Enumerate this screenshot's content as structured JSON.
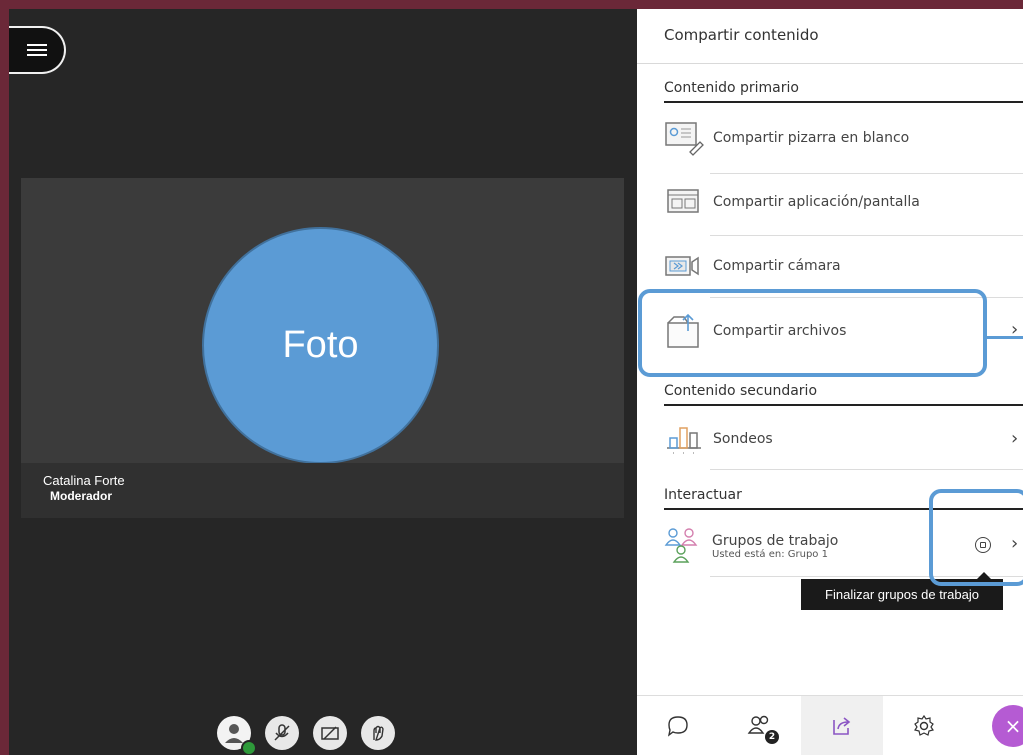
{
  "video": {
    "photo_label": "Foto",
    "participant_name": "Catalina Forte",
    "participant_role": "Moderador"
  },
  "panel": {
    "title": "Compartir contenido",
    "primary_heading": "Contenido primario",
    "primary_items": [
      {
        "label": "Compartir pizarra en blanco",
        "icon": "whiteboard-icon"
      },
      {
        "label": "Compartir aplicación/pantalla",
        "icon": "screen-share-icon"
      },
      {
        "label": "Compartir cámara",
        "icon": "camera-share-icon"
      },
      {
        "label": "Compartir archivos",
        "icon": "folder-upload-icon"
      }
    ],
    "secondary_heading": "Contenido secundario",
    "polls_label": "Sondeos",
    "interact_heading": "Interactuar",
    "groups_label": "Grupos de trabajo",
    "groups_sublabel": "Usted está en: Grupo 1",
    "tooltip": "Finalizar grupos de trabajo"
  },
  "bottom_bar": {
    "attendees_badge": "2",
    "close_symbol": "×"
  },
  "colors": {
    "background": "#6b2838",
    "highlight": "#5b9bd5",
    "photo_fill": "#5b9bd5",
    "close_button": "#b55bd3"
  }
}
